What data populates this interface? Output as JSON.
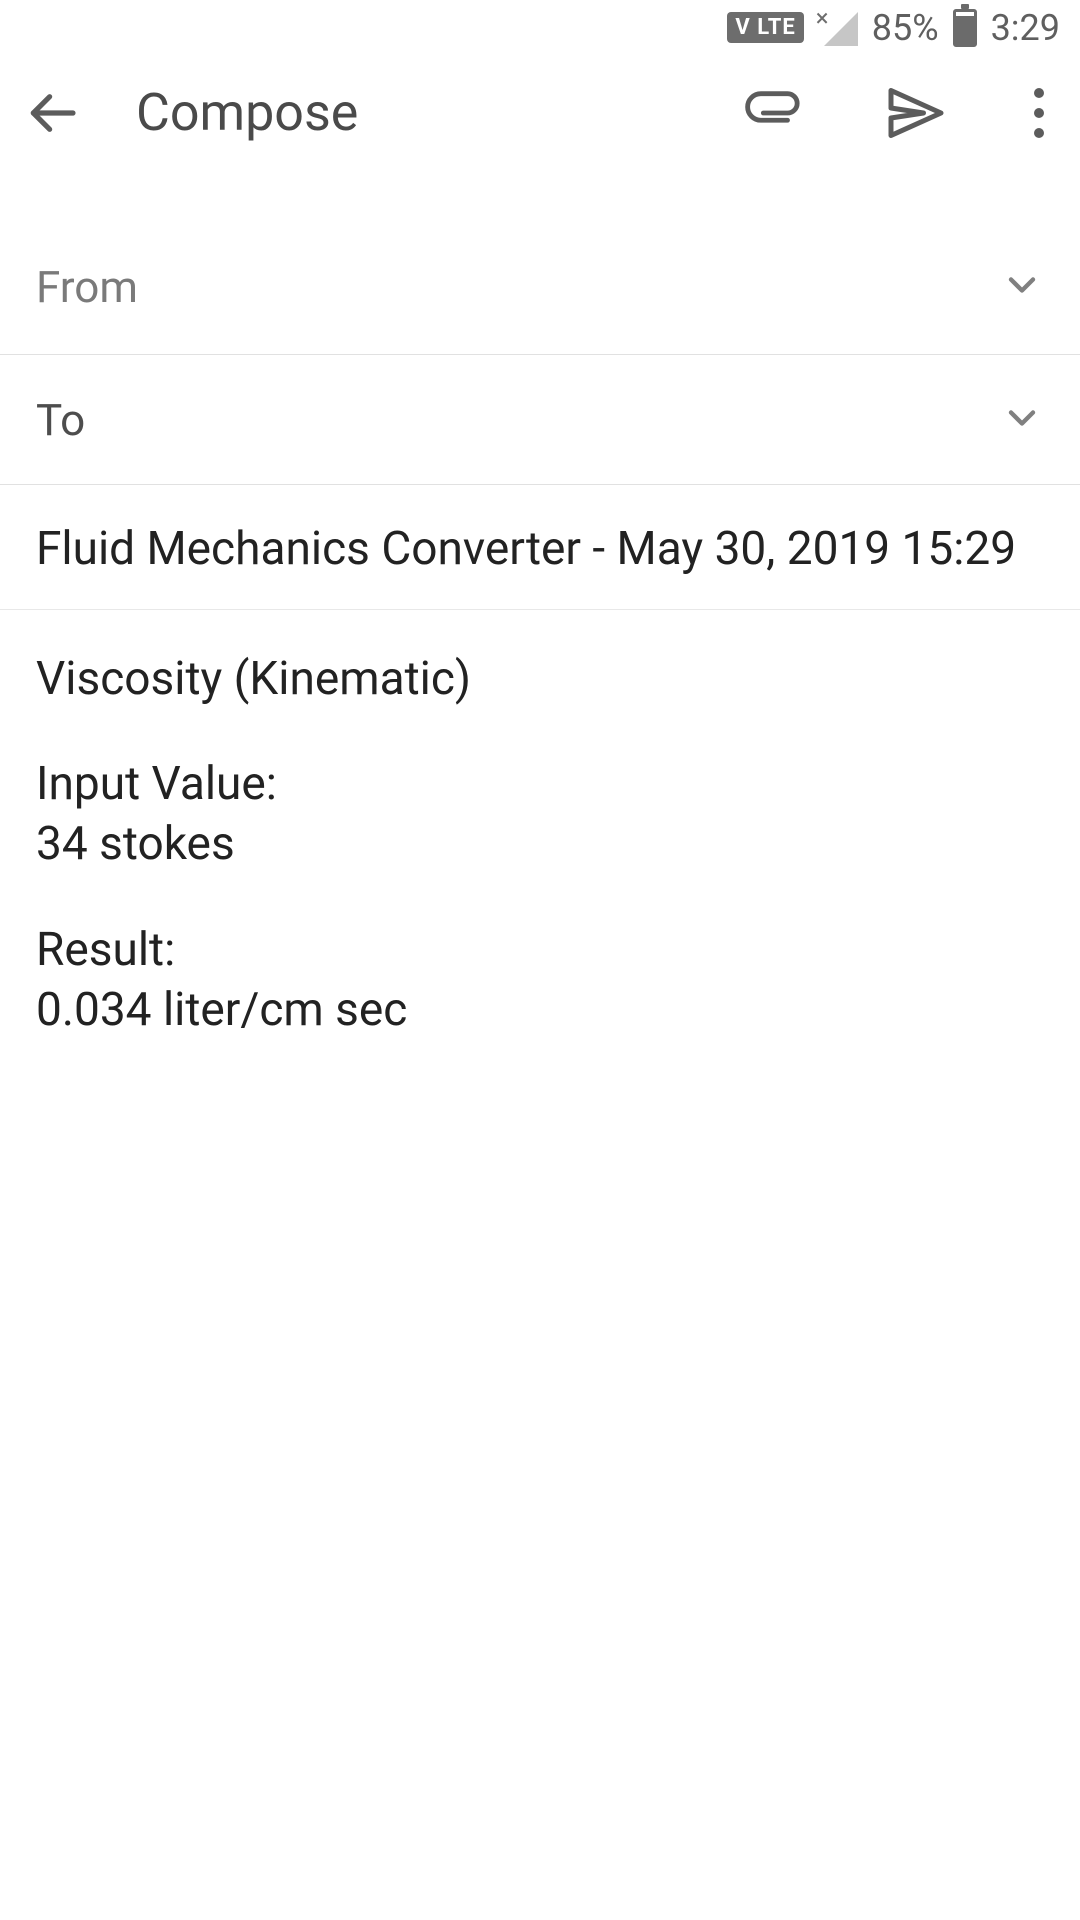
{
  "status": {
    "volte": "V LTE",
    "battery_label": "85%",
    "battery_fill_pct": 85,
    "clock": "3:29"
  },
  "appbar": {
    "title": "Compose"
  },
  "fields": {
    "from_label": "From",
    "to_label": "To"
  },
  "subject": "Fluid Mechanics Converter - May 30, 2019 15:29",
  "body": {
    "heading": "Viscosity (Kinematic)",
    "input_label": "Input Value:",
    "input_value": "34 stokes",
    "result_label": "Result:",
    "result_value": "0.034 liter/cm sec"
  }
}
